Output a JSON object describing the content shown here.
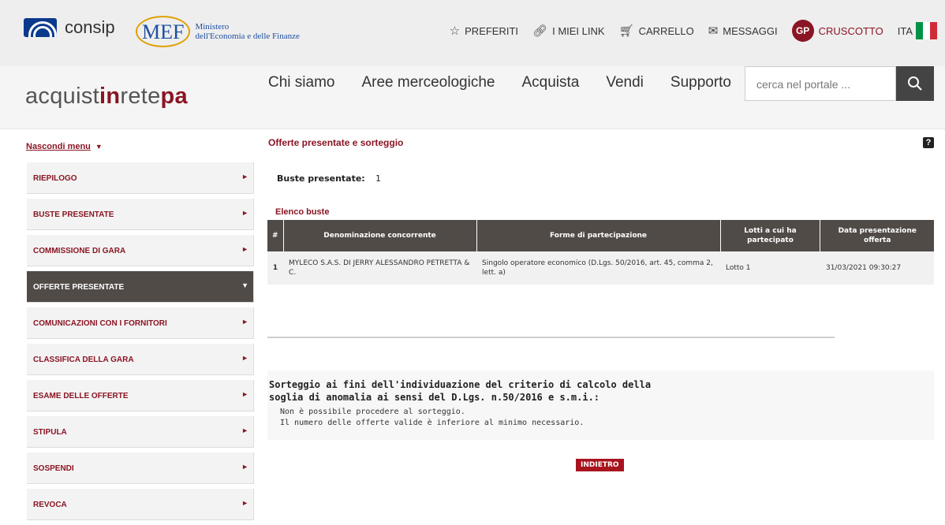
{
  "topbar": {
    "consip_label": "consip",
    "mef_mark": "MEF",
    "mef_line1": "Ministero",
    "mef_line2": "dell'Economia e delle Finanze",
    "links": [
      {
        "label": "PREFERITI",
        "icon": "star-icon"
      },
      {
        "label": "I MIEI LINK",
        "icon": "link-icon"
      },
      {
        "label": "CARRELLO",
        "icon": "cart-icon"
      },
      {
        "label": "MESSAGGI",
        "icon": "envelope-icon"
      }
    ],
    "avatar_initials": "GP",
    "dashboard_label": "CRUSCOTTO",
    "language": "ITA"
  },
  "header": {
    "brand_part1": "acquist",
    "brand_part2": "in",
    "brand_part3": "rete",
    "brand_part4": "pa",
    "nav": [
      "Chi siamo",
      "Aree merceologiche",
      "Acquista",
      "Vendi",
      "Supporto"
    ],
    "search_placeholder": "cerca nel portale ..."
  },
  "sidebar": {
    "toggle_label": "Nascondi menu",
    "items": [
      {
        "label": "RIEPILOGO",
        "active": false
      },
      {
        "label": "BUSTE PRESENTATE",
        "active": false
      },
      {
        "label": "COMMISSIONE DI GARA",
        "active": false
      },
      {
        "label": "OFFERTE PRESENTATE",
        "active": true
      },
      {
        "label": "COMUNICAZIONI CON I FORNITORI",
        "active": false
      },
      {
        "label": "CLASSIFICA DELLA GARA",
        "active": false
      },
      {
        "label": "ESAME DELLE OFFERTE",
        "active": false
      },
      {
        "label": "STIPULA",
        "active": false
      },
      {
        "label": "SOSPENDI",
        "active": false
      },
      {
        "label": "REVOCA",
        "active": false
      }
    ]
  },
  "content": {
    "title": "Offerte presentate e sorteggio",
    "buste_label": "Buste presentate:",
    "buste_count": "1",
    "list_title": "Elenco buste",
    "table": {
      "headers": [
        "#",
        "Denominazione concorrente",
        "Forme di partecipazione",
        "Lotti a cui ha partecipato",
        "Data presentazione offerta"
      ],
      "rows": [
        [
          "1",
          "MYLECO S.A.S. DI JERRY ALESSANDRO PETRETTA & C.",
          "Singolo operatore economico (D.Lgs. 50/2016, art. 45, comma 2, lett. a)",
          "Lotto 1",
          "31/03/2021 09:30:27"
        ]
      ]
    },
    "sorteggio_title": "Sorteggio ai fini dell'individuazione del criterio di calcolo della soglia di anomalia ai sensi del D.Lgs. n.50/2016 e s.m.i.:",
    "sorteggio_msg1": "Non è possibile procedere al sorteggio.",
    "sorteggio_msg2": "Il numero delle offerte valide è inferiore al minimo necessario.",
    "back_label": "INDIETRO"
  },
  "colors": {
    "accent": "#8a1524",
    "dark": "#514b48",
    "button": "#a8141e"
  }
}
